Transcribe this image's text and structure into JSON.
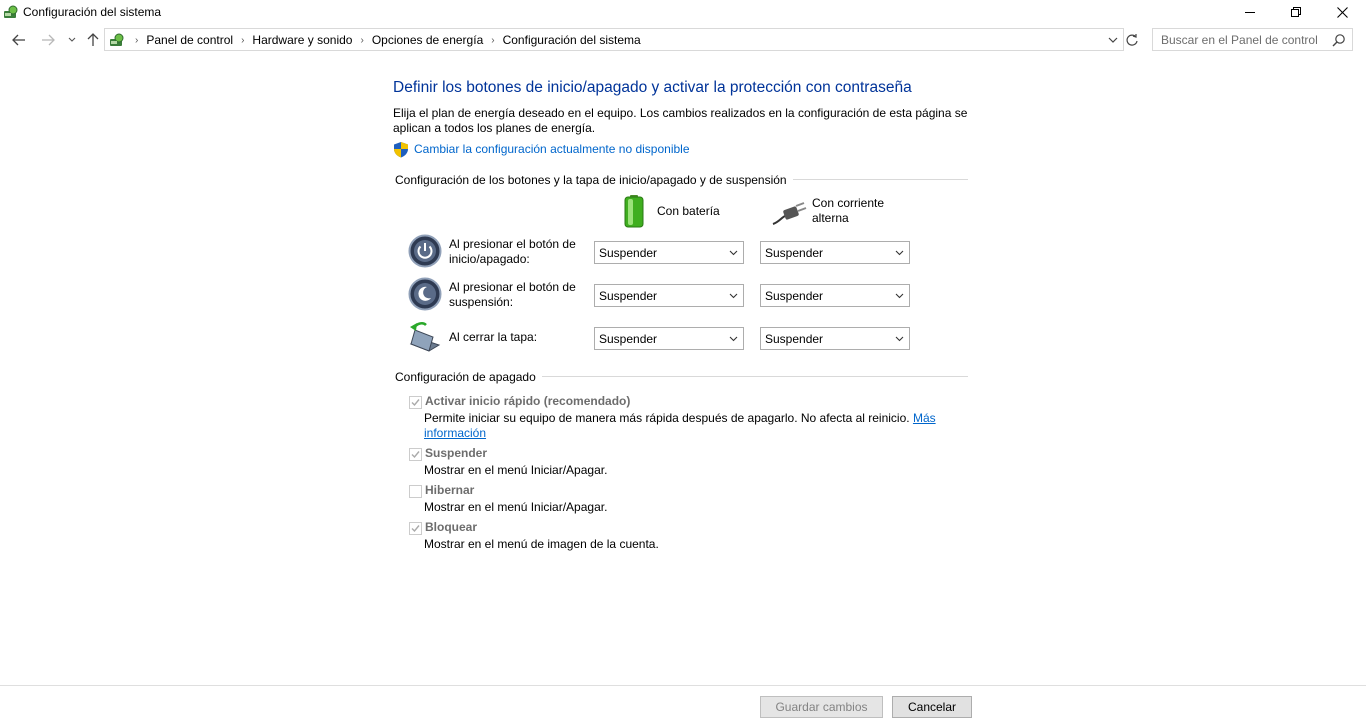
{
  "window": {
    "title": "Configuración del sistema"
  },
  "address_bar": {
    "breadcrumbs": [
      "Panel de control",
      "Hardware y sonido",
      "Opciones de energía",
      "Configuración del sistema"
    ]
  },
  "search": {
    "placeholder": "Buscar en el Panel de control"
  },
  "main": {
    "heading": "Definir los botones de inicio/apagado y activar la protección con contraseña",
    "description": "Elija el plan de energía deseado en el equipo. Los cambios realizados en la configuración de esta página se aplican a todos los planes de energía.",
    "change_link": "Cambiar la configuración actualmente no disponible"
  },
  "buttons_section": {
    "title": "Configuración de los botones y la tapa de inicio/apagado y de suspensión",
    "columns": {
      "battery": "Con batería",
      "ac": "Con corriente alterna"
    },
    "rows": [
      {
        "label": "Al presionar el botón de inicio/apagado:",
        "battery": "Suspender",
        "ac": "Suspender"
      },
      {
        "label": "Al presionar el botón de suspensión:",
        "battery": "Suspender",
        "ac": "Suspender"
      },
      {
        "label": "Al cerrar la tapa:",
        "battery": "Suspender",
        "ac": "Suspender"
      }
    ]
  },
  "shutdown_section": {
    "title": "Configuración de apagado",
    "options": [
      {
        "label": "Activar inicio rápido (recomendado)",
        "checked": true,
        "description": "Permite iniciar su equipo de manera más rápida después de apagarlo. No afecta al reinicio.",
        "link": "Más información"
      },
      {
        "label": "Suspender",
        "checked": true,
        "description": "Mostrar en el menú Iniciar/Apagar."
      },
      {
        "label": "Hibernar",
        "checked": false,
        "description": "Mostrar en el menú Iniciar/Apagar."
      },
      {
        "label": "Bloquear",
        "checked": true,
        "description": "Mostrar en el menú de imagen de la cuenta."
      }
    ]
  },
  "footer": {
    "save_label": "Guardar cambios",
    "cancel_label": "Cancelar"
  },
  "colors": {
    "heading": "#003399",
    "link": "#0066cc",
    "disabled_text": "#6d6d6d"
  }
}
